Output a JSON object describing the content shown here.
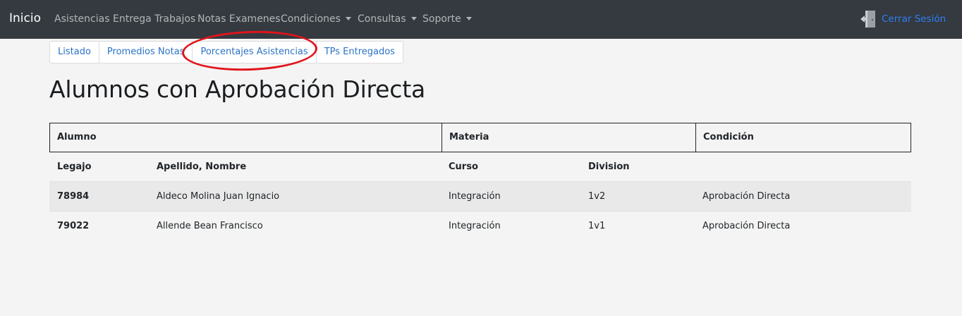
{
  "navbar": {
    "brand": "Inicio",
    "items": [
      "Asistencias",
      "Entrega Trabajos",
      "Notas Examenes",
      "Condiciones",
      "Consultas",
      "Soporte"
    ],
    "logout_label": "Cerrar Sesión"
  },
  "tabs": [
    "Listado",
    "Promedios Notas",
    "Porcentajes Asistencias",
    "TPs Entregados"
  ],
  "page_title": "Alumnos con Aprobación Directa",
  "table": {
    "group_headers": [
      "Alumno",
      "Materia",
      "Condición"
    ],
    "column_headers": [
      "Legajo",
      "Apellido, Nombre",
      "Curso",
      "Division"
    ],
    "rows": [
      {
        "legajo": "78984",
        "nombre": "Aldeco Molina Juan Ignacio",
        "curso": "Integración",
        "division": "1v2",
        "condicion": "Aprobación Directa"
      },
      {
        "legajo": "79022",
        "nombre": "Allende Bean Francisco",
        "curso": "Integración",
        "division": "1v1",
        "condicion": "Aprobación Directa"
      }
    ]
  },
  "colors": {
    "navbar": "#343a40",
    "link": "#2a73c6",
    "annotation": "#e1141c"
  }
}
